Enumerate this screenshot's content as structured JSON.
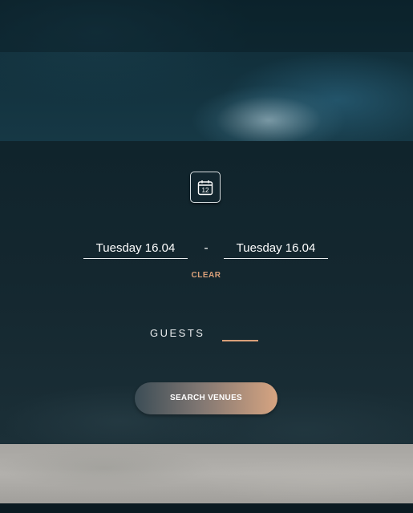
{
  "date_picker": {
    "calendar_icon_number": "12",
    "start_date": "Tuesday 16.04",
    "separator": "-",
    "end_date": "Tuesday 16.04",
    "clear_label": "CLEAR"
  },
  "guests": {
    "label": "GUESTS",
    "value": ""
  },
  "search": {
    "button_label": "SEARCH VENUES"
  },
  "colors": {
    "accent": "#d9a07a",
    "panel_background": "#14272f",
    "text": "#ffffff"
  },
  "icons": {
    "calendar": "calendar-icon"
  }
}
